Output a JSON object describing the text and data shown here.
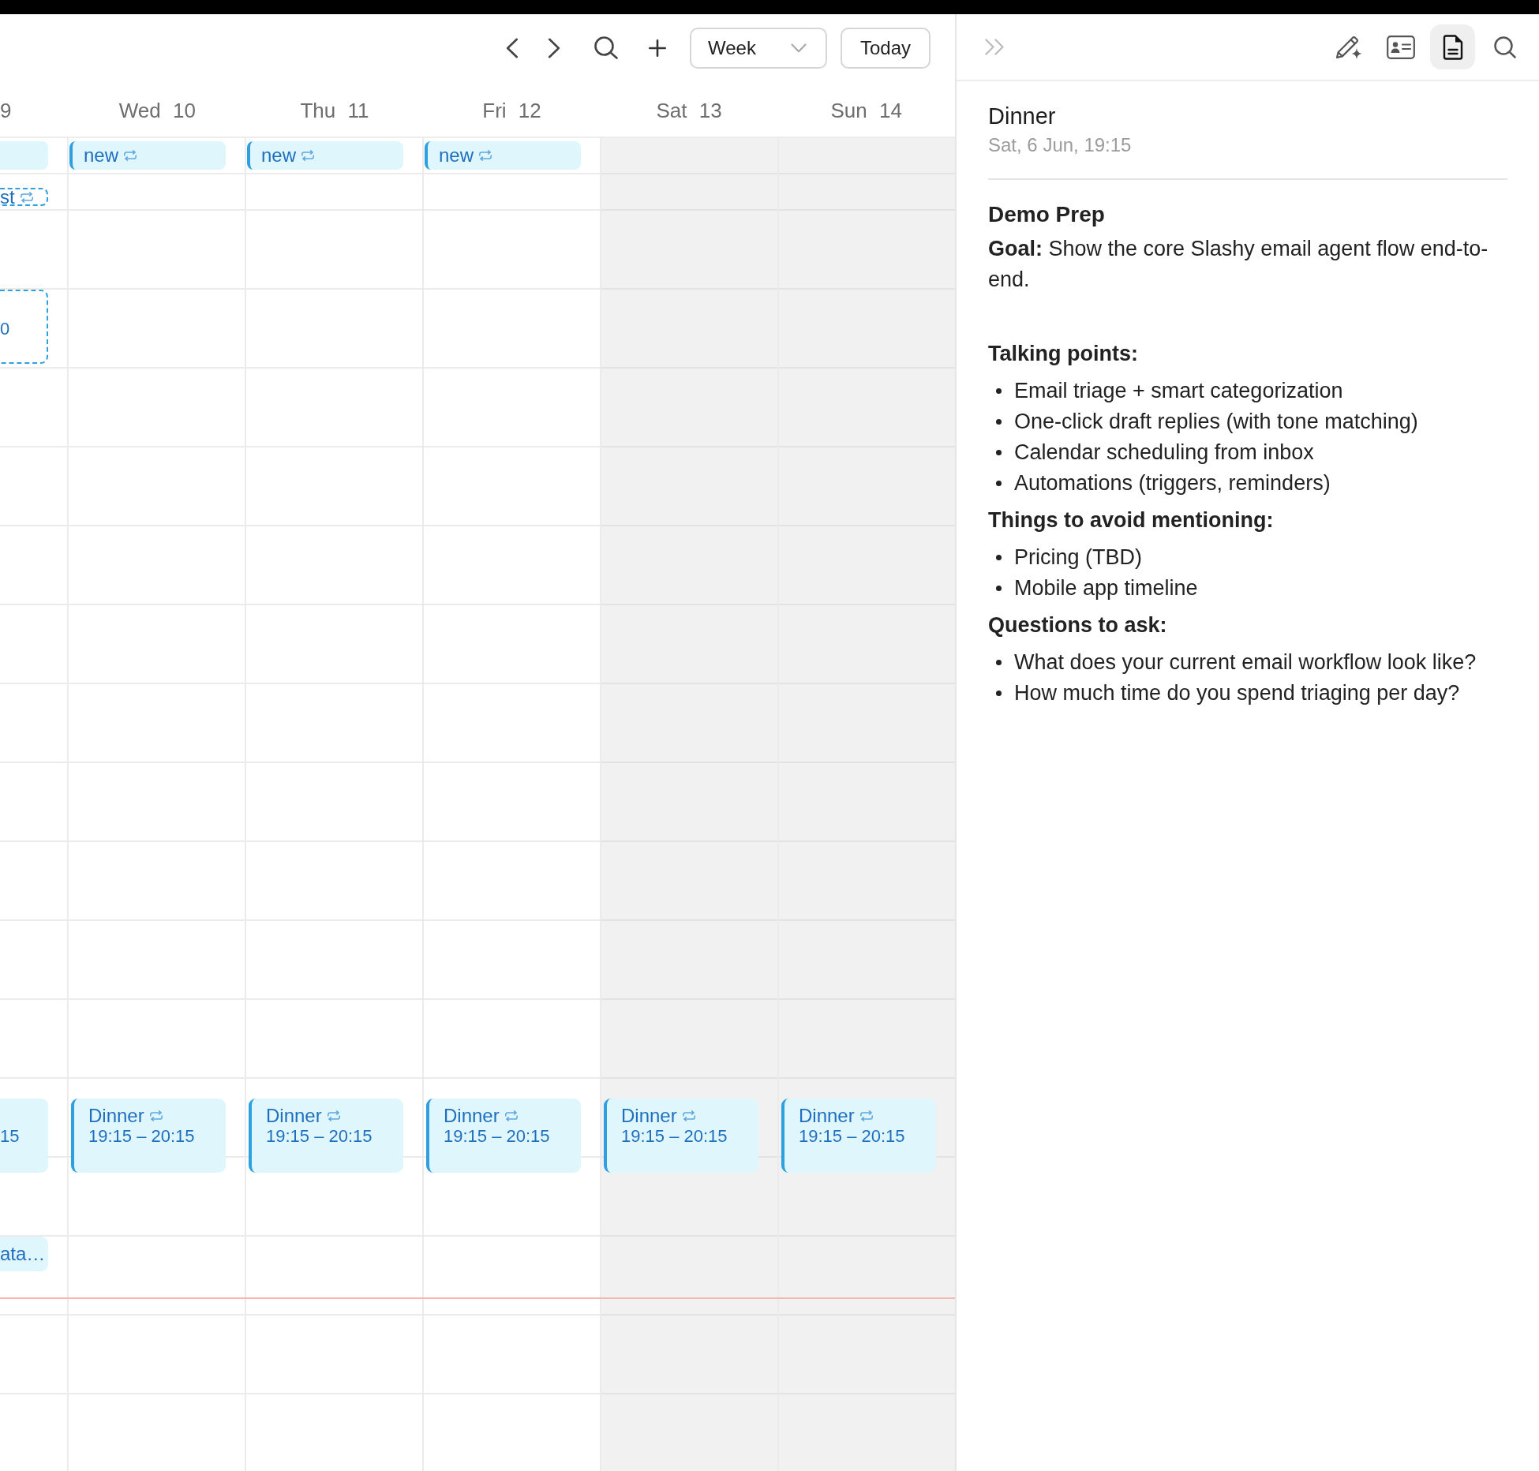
{
  "toolbar": {
    "view": "Week",
    "today": "Today"
  },
  "calendar": {
    "days": [
      {
        "label": "9",
        "clipped": true,
        "weekend": false,
        "all_day": [
          {
            "tentative": false,
            "recurring": false
          },
          {
            "title": "st",
            "tentative": true,
            "recurring": true
          }
        ],
        "events": [
          {
            "time": "0",
            "tentative": true,
            "recurring": false
          },
          {
            "time": "15",
            "tentative": false,
            "recurring": false
          },
          {
            "title": "ata…",
            "tentative": false,
            "recurring": false
          }
        ]
      },
      {
        "label": "Wed 10",
        "clipped": false,
        "weekend": false,
        "all_day": [
          {
            "title": "new",
            "tentative": false,
            "recurring": true
          }
        ],
        "events": [
          {
            "title": "Dinner",
            "time": "19:15 – 20:15",
            "tentative": false,
            "recurring": true
          }
        ]
      },
      {
        "label": "Thu 11",
        "clipped": false,
        "weekend": false,
        "all_day": [
          {
            "title": "new",
            "tentative": false,
            "recurring": true
          }
        ],
        "events": [
          {
            "title": "Dinner",
            "time": "19:15 – 20:15",
            "tentative": false,
            "recurring": true
          }
        ]
      },
      {
        "label": "Fri 12",
        "clipped": false,
        "weekend": false,
        "all_day": [
          {
            "title": "new",
            "tentative": false,
            "recurring": true
          }
        ],
        "events": [
          {
            "title": "Dinner",
            "time": "19:15 – 20:15",
            "tentative": false,
            "recurring": true
          }
        ]
      },
      {
        "label": "Sat 13",
        "clipped": false,
        "weekend": true,
        "events": [
          {
            "title": "Dinner",
            "time": "19:15 – 20:15",
            "tentative": false,
            "recurring": true
          }
        ]
      },
      {
        "label": "Sun 14",
        "clipped": false,
        "weekend": true,
        "events": [
          {
            "title": "Dinner",
            "time": "19:15 – 20:15",
            "tentative": false,
            "recurring": true
          }
        ]
      }
    ]
  },
  "panel": {
    "tabs": [
      {
        "kind": "compose",
        "selected": false
      },
      {
        "kind": "contact",
        "selected": false
      },
      {
        "kind": "notes",
        "selected": true
      },
      {
        "kind": "search",
        "selected": false
      }
    ],
    "title": "Dinner",
    "when": "Sat, 6 Jun, 19:15",
    "note": [
      {
        "kind": "title",
        "text": "Demo Prep"
      },
      {
        "kind": "paragraph",
        "text": "**Goal:** Show the core Slashy email agent flow end-to-end."
      },
      {
        "kind": "heading",
        "text": "Talking points:"
      },
      {
        "kind": "list",
        "items": [
          "Email triage + smart categorization",
          "One-click draft replies (with tone matching)",
          "Calendar scheduling from inbox",
          "Automations (triggers, reminders)"
        ]
      },
      {
        "kind": "heading",
        "text": "Things to avoid mentioning:"
      },
      {
        "kind": "list",
        "items": [
          "Pricing (TBD)",
          "Mobile app timeline"
        ]
      },
      {
        "kind": "heading",
        "text": "Questions to ask:"
      },
      {
        "kind": "list",
        "items": [
          "What does your current email workflow look like?",
          "How much time do you spend triaging per day?"
        ]
      }
    ]
  }
}
